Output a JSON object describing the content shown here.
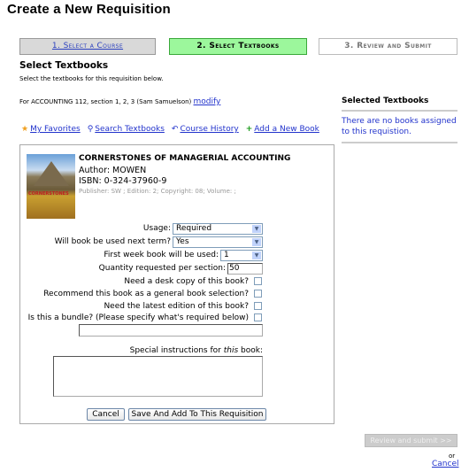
{
  "title": "Create a New Requisition",
  "steps": [
    {
      "label": "1. Select a Course"
    },
    {
      "label": "2. Select Textbooks"
    },
    {
      "label": "3. Review and Submit"
    }
  ],
  "section": {
    "heading": "Select Textbooks",
    "subtitle": "Select the textbooks for this requisition below.",
    "course_info": "For ACCOUNTING 112, section 1, 2, 3 (Sam Samuelson)",
    "modify": "modify"
  },
  "links": [
    {
      "label": "My Favorites",
      "icon": "star-icon"
    },
    {
      "label": "Search Textbooks",
      "icon": "search-icon"
    },
    {
      "label": "Course History",
      "icon": "history-icon"
    },
    {
      "label": "Add a New Book",
      "icon": "plus-icon"
    }
  ],
  "sidebar": {
    "heading": "Selected Textbooks",
    "empty": "There are no books assigned to this requistion."
  },
  "book": {
    "title": "CORNERSTONES OF MANAGERIAL ACCOUNTING",
    "author": "Author: MOWEN",
    "isbn": "ISBN: 0-324-37960-9",
    "publisher": "Publisher: SW ; Edition: 2; Copyright: 08; Volume: ;",
    "cover_text": "CORNERSTONES"
  },
  "form": {
    "usage_label": "Usage:",
    "usage_value": "Required",
    "next_term_label": "Will book be used next term?",
    "next_term_value": "Yes",
    "first_week_label": "First week book will be used:",
    "first_week_value": "1",
    "quantity_label": "Quantity requested per section:",
    "quantity_value": "50",
    "desk_copy_label": "Need a desk copy of this book?",
    "recommend_label": "Recommend this book as a general book selection?",
    "latest_label": "Need the latest edition of this book?",
    "bundle_label": "Is this a bundle? (Please specify what's required below)",
    "bundle_value": "",
    "special_prefix": "Special instructions for ",
    "special_em": "this",
    "special_suffix": " book:",
    "special_value": "",
    "cancel": "Cancel",
    "save": "Save And Add To This Requisition"
  },
  "footer": {
    "review": "Review and submit >>",
    "or": "or",
    "cancel": "Cancel"
  }
}
